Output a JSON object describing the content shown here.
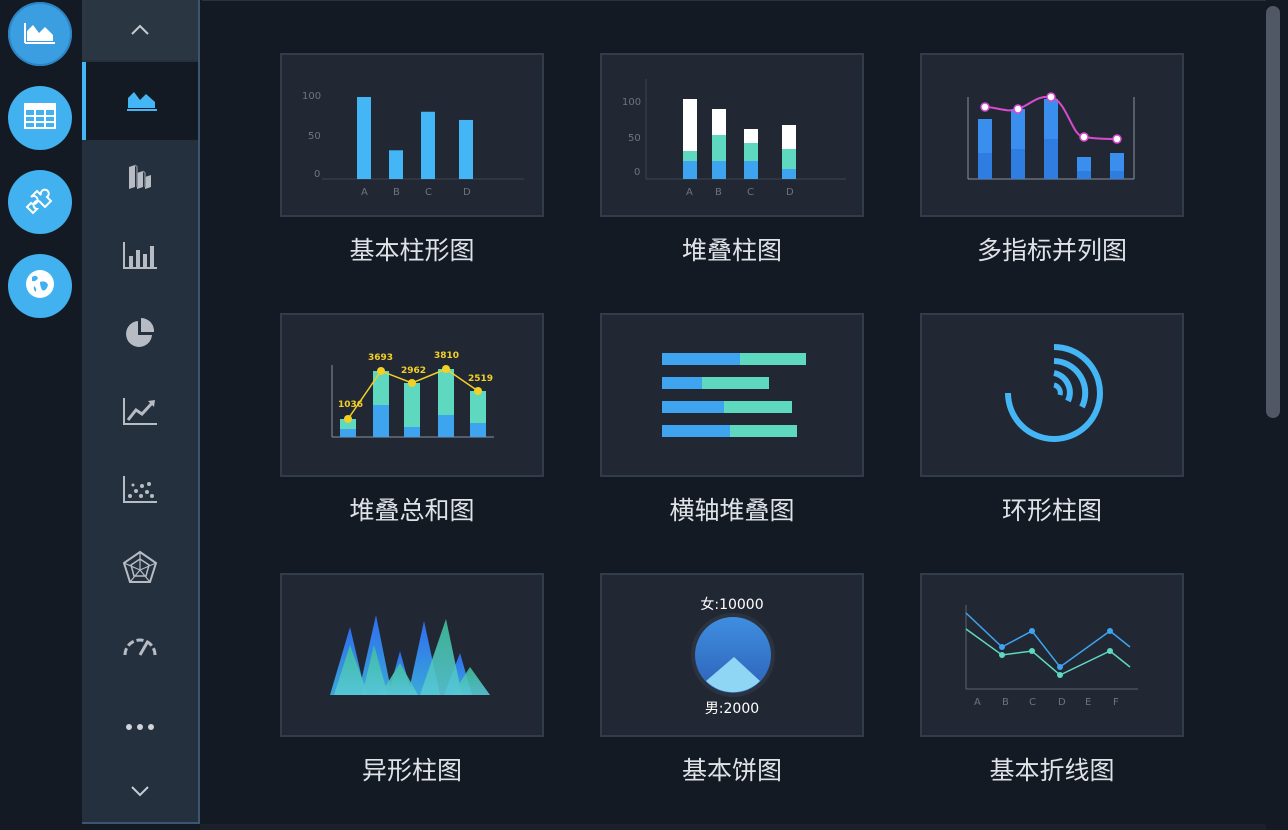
{
  "rail": [
    {
      "name": "area-chart-icon",
      "active": true
    },
    {
      "name": "table-icon",
      "active": false
    },
    {
      "name": "puzzle-icon",
      "active": false
    },
    {
      "name": "globe-icon",
      "active": false
    }
  ],
  "sidebar": {
    "items": [
      "area-chart-icon",
      "stacked-bar-3d-icon",
      "bar-chart-icon",
      "pie-chart-icon",
      "line-trend-icon",
      "scatter-icon",
      "radar-icon",
      "gauge-icon",
      "more-icon"
    ]
  },
  "cards": [
    {
      "label": "基本柱形图"
    },
    {
      "label": "堆叠柱图"
    },
    {
      "label": "多指标并列图"
    },
    {
      "label": "堆叠总和图"
    },
    {
      "label": "横轴堆叠图"
    },
    {
      "label": "环形柱图"
    },
    {
      "label": "异形柱图"
    },
    {
      "label": "基本饼图"
    },
    {
      "label": "基本折线图"
    }
  ],
  "thumbnails": {
    "basic_bar": {
      "yticks": [
        "100",
        "50",
        "0"
      ],
      "categories": [
        "A",
        "B",
        "C",
        "D"
      ],
      "values": [
        100,
        35,
        82,
        72
      ]
    },
    "stacked_bar": {
      "yticks": [
        "100",
        "50",
        "0"
      ],
      "categories": [
        "A",
        "B",
        "C",
        "D"
      ]
    },
    "stacked_total": {
      "values": [
        "1036",
        "3693",
        "2962",
        "3810",
        "2519"
      ]
    },
    "pie": {
      "female": "女:10000",
      "male": "男:2000"
    },
    "line": {
      "categories": [
        "A",
        "B",
        "C",
        "D",
        "E",
        "F"
      ]
    }
  },
  "colors": {
    "accent": "#45b6f5",
    "teal": "#5fd8c0",
    "blue": "#3ea4f0",
    "gold": "#f2d027"
  }
}
